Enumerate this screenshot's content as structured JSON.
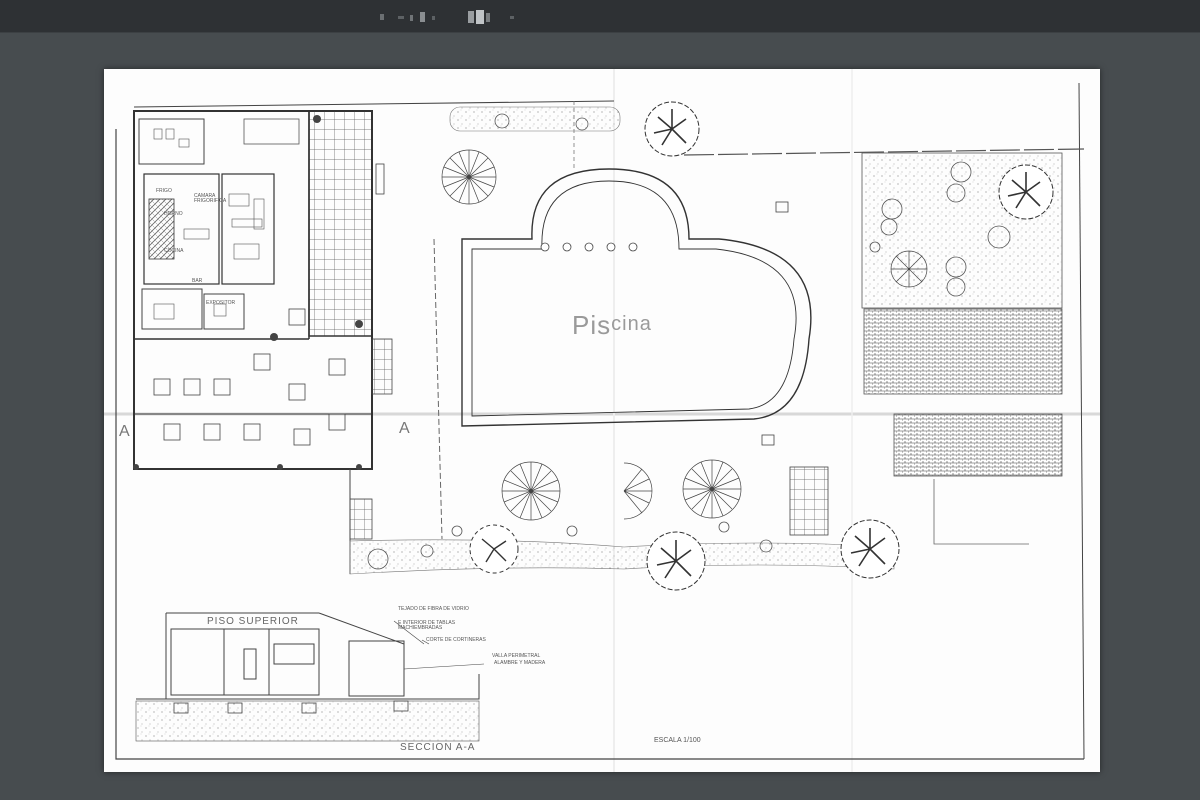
{
  "window": {
    "title": "plano"
  },
  "drawing": {
    "pool_label_main": "Pis",
    "pool_label_sup": "cina",
    "section_marker_left": "A",
    "section_marker_right": "A",
    "kitchen_labels": [
      "FRIGO",
      "HORNO",
      "CAMARA FRIGORIFICA",
      "COCINA",
      "EXPOSITOR",
      "BAR"
    ],
    "section": {
      "floor_label": "PISO SUPERIOR",
      "note_roof": "TEJADO DE FIBRA DE VIDRIO",
      "note_roof2": "E INTERIOR DE TABLAS MACHIEMBRADAS",
      "note_curtain": "CORTE DE CORTINERAS",
      "note_fence": "VALLA PERIMETRAL",
      "note_fence2": "ALAMBRE Y MADERA",
      "title": "SECCION A-A",
      "scale": "ESCALA 1/100"
    }
  },
  "colors": {
    "background": "#474c4f",
    "titlebar": "#2e3134",
    "paper": "#fdfdfd",
    "ink": "#3a3a3a"
  }
}
